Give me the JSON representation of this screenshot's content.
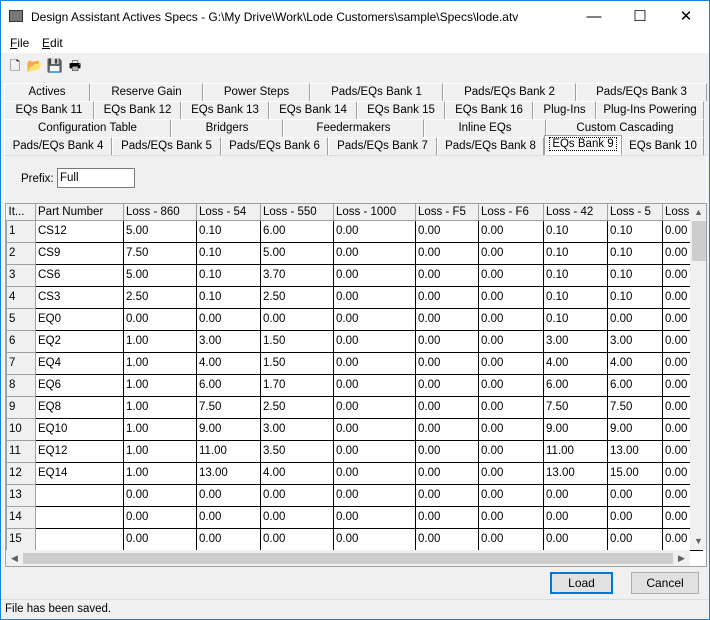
{
  "window": {
    "title": "Design Assistant Actives Specs - G:\\My Drive\\Work\\Lode Customers\\sample\\Specs\\lode.atv",
    "minimize": "—",
    "maximize": "☐",
    "close": "✕"
  },
  "menu": [
    {
      "label": "File",
      "accel": "F"
    },
    {
      "label": "Edit",
      "accel": "E"
    }
  ],
  "toolbar": [
    {
      "icon": "new-file-icon",
      "glyph": "🗋"
    },
    {
      "icon": "open-folder-icon",
      "glyph": "📂"
    },
    {
      "icon": "save-icon",
      "glyph": "💾"
    },
    {
      "icon": "print-icon",
      "glyph": "🖶"
    }
  ],
  "tab_rows": [
    [
      "Actives",
      "Reserve Gain",
      "Power Steps",
      "Pads/EQs Bank 1",
      "Pads/EQs Bank 2",
      "Pads/EQs Bank 3"
    ],
    [
      "EQs Bank 11",
      "EQs Bank 12",
      "EQs Bank 13",
      "EQs Bank 14",
      "EQs Bank 15",
      "EQs Bank 16",
      "Plug-Ins",
      "Plug-Ins Powering"
    ],
    [
      "Configuration Table",
      "Bridgers",
      "Feedermakers",
      "Inline EQs",
      "Custom Cascading"
    ],
    [
      "Pads/EQs Bank 4",
      "Pads/EQs Bank 5",
      "Pads/EQs Bank 6",
      "Pads/EQs Bank 7",
      "Pads/EQs Bank 8",
      "EQs Bank 9",
      "EQs Bank 10"
    ]
  ],
  "selected_tab": "EQs Bank 9",
  "prefix": {
    "label": "Prefix:",
    "value": "Full"
  },
  "grid": {
    "columns": [
      "It...",
      "Part Number",
      "Loss - 860",
      "Loss - 54",
      "Loss - 550",
      "Loss - 1000",
      "Loss - F5",
      "Loss - F6",
      "Loss - 42",
      "Loss - 5",
      "Loss"
    ],
    "rows": [
      [
        "1",
        "CS12",
        "5.00",
        "0.10",
        "6.00",
        "0.00",
        "0.00",
        "0.00",
        "0.10",
        "0.10",
        "0.00"
      ],
      [
        "2",
        "CS9",
        "7.50",
        "0.10",
        "5.00",
        "0.00",
        "0.00",
        "0.00",
        "0.10",
        "0.10",
        "0.00"
      ],
      [
        "3",
        "CS6",
        "5.00",
        "0.10",
        "3.70",
        "0.00",
        "0.00",
        "0.00",
        "0.10",
        "0.10",
        "0.00"
      ],
      [
        "4",
        "CS3",
        "2.50",
        "0.10",
        "2.50",
        "0.00",
        "0.00",
        "0.00",
        "0.10",
        "0.10",
        "0.00"
      ],
      [
        "5",
        "EQ0",
        "0.00",
        "0.00",
        "0.00",
        "0.00",
        "0.00",
        "0.00",
        "0.10",
        "0.00",
        "0.00"
      ],
      [
        "6",
        "EQ2",
        "1.00",
        "3.00",
        "1.50",
        "0.00",
        "0.00",
        "0.00",
        "3.00",
        "3.00",
        "0.00"
      ],
      [
        "7",
        "EQ4",
        "1.00",
        "4.00",
        "1.50",
        "0.00",
        "0.00",
        "0.00",
        "4.00",
        "4.00",
        "0.00"
      ],
      [
        "8",
        "EQ6",
        "1.00",
        "6.00",
        "1.70",
        "0.00",
        "0.00",
        "0.00",
        "6.00",
        "6.00",
        "0.00"
      ],
      [
        "9",
        "EQ8",
        "1.00",
        "7.50",
        "2.50",
        "0.00",
        "0.00",
        "0.00",
        "7.50",
        "7.50",
        "0.00"
      ],
      [
        "10",
        "EQ10",
        "1.00",
        "9.00",
        "3.00",
        "0.00",
        "0.00",
        "0.00",
        "9.00",
        "9.00",
        "0.00"
      ],
      [
        "11",
        "EQ12",
        "1.00",
        "11.00",
        "3.50",
        "0.00",
        "0.00",
        "0.00",
        "11.00",
        "13.00",
        "0.00"
      ],
      [
        "12",
        "EQ14",
        "1.00",
        "13.00",
        "4.00",
        "0.00",
        "0.00",
        "0.00",
        "13.00",
        "15.00",
        "0.00"
      ],
      [
        "13",
        "",
        "0.00",
        "0.00",
        "0.00",
        "0.00",
        "0.00",
        "0.00",
        "0.00",
        "0.00",
        "0.00"
      ],
      [
        "14",
        "",
        "0.00",
        "0.00",
        "0.00",
        "0.00",
        "0.00",
        "0.00",
        "0.00",
        "0.00",
        "0.00"
      ],
      [
        "15",
        "",
        "0.00",
        "0.00",
        "0.00",
        "0.00",
        "0.00",
        "0.00",
        "0.00",
        "0.00",
        "0.00"
      ]
    ]
  },
  "buttons": {
    "load": "Load",
    "cancel": "Cancel"
  },
  "status": "File has been saved."
}
